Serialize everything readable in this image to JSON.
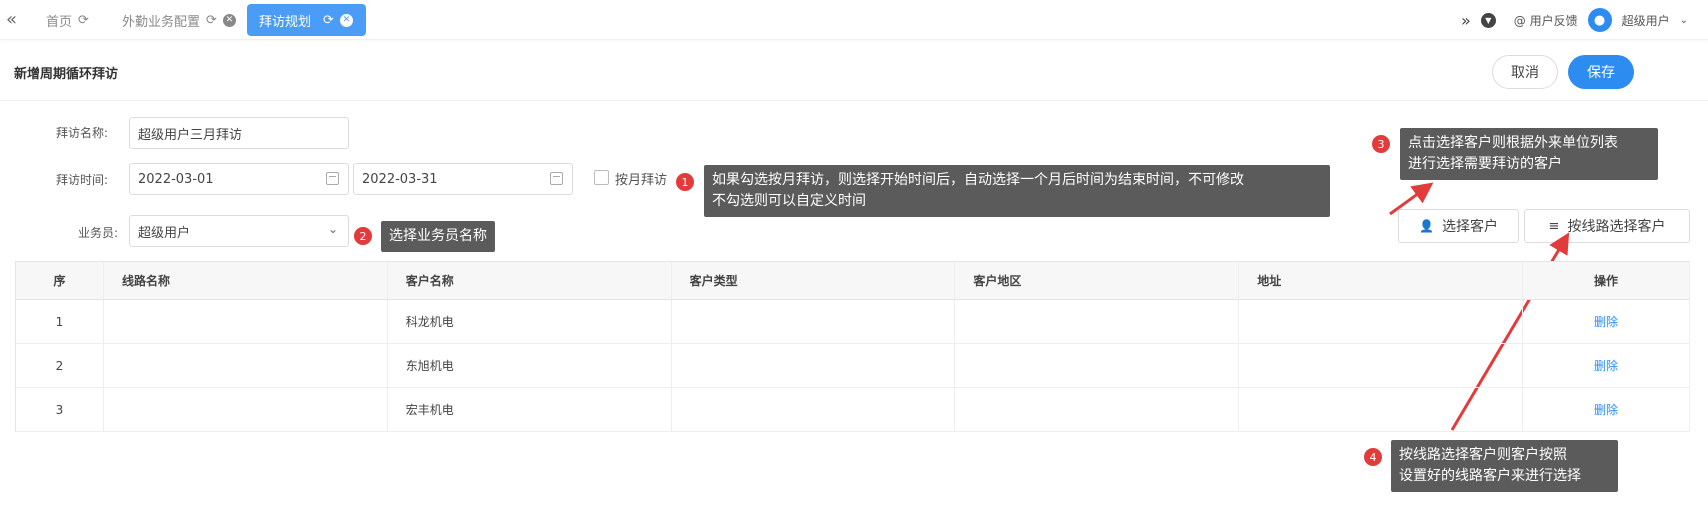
{
  "tabs": [
    {
      "label": "首页",
      "has_close": false
    },
    {
      "label": "外勤业务配置",
      "has_close": true
    },
    {
      "label": "拜访规划",
      "has_close": true,
      "active": true
    }
  ],
  "topright": {
    "feedback": "@ 用户反馈",
    "user": "超级用户"
  },
  "page": {
    "title": "新增周期循环拜访",
    "cancel": "取消",
    "save": "保存"
  },
  "form": {
    "name_label": "拜访名称:",
    "name_value": "超级用户三月拜访",
    "time_label": "拜访时间:",
    "start_date": "2022-03-01",
    "end_date": "2022-03-31",
    "monthly_label": "按月拜访",
    "salesman_label": "业务员:",
    "salesman_value": "超级用户"
  },
  "actions": {
    "select_customer": "选择客户",
    "select_by_route": "按线路选择客户"
  },
  "tips": {
    "t1": "如果勾选按月拜访，则选择开始时间后，自动选择一个月后时间为结束时间，不可修改",
    "t1b": "不勾选则可以自定义时间",
    "t2": "选择业务员名称",
    "t3a": "点击选择客户则根据外来单位列表",
    "t3b": "进行选择需要拜访的客户",
    "t4a": "按线路选择客户则客户按照",
    "t4b": "设置好的线路客户来进行选择",
    "n1": "1",
    "n2": "2",
    "n3": "3",
    "n4": "4"
  },
  "table": {
    "headers": [
      "序",
      "线路名称",
      "客户名称",
      "客户类型",
      "客户地区",
      "地址",
      "操作"
    ],
    "rows": [
      {
        "idx": "1",
        "route": "",
        "customer": "科龙机电",
        "type": "",
        "region": "",
        "address": "",
        "op": "删除"
      },
      {
        "idx": "2",
        "route": "",
        "customer": "东旭机电",
        "type": "",
        "region": "",
        "address": "",
        "op": "删除"
      },
      {
        "idx": "3",
        "route": "",
        "customer": "宏丰机电",
        "type": "",
        "region": "",
        "address": "",
        "op": "删除"
      }
    ]
  },
  "colors": {
    "accent": "#2d8cf0",
    "active_tab": "#4a9cf6",
    "tip_bg": "#5b5b5b",
    "badge": "#e23b3b"
  }
}
